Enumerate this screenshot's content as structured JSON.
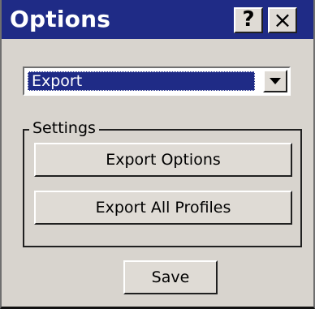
{
  "window": {
    "title": "Options",
    "help_label": "?",
    "close_label": "×"
  },
  "dropdown": {
    "selected": "Export",
    "arrow_icon": "triangle-down-icon"
  },
  "settings": {
    "group_label": "Settings",
    "export_options_label": "Export Options",
    "export_all_profiles_label": "Export All Profiles"
  },
  "footer": {
    "save_label": "Save"
  },
  "colors": {
    "titlebar": "#1f2b86",
    "dialog_background": "#d8d4ce",
    "selection": "#1f2b86"
  }
}
